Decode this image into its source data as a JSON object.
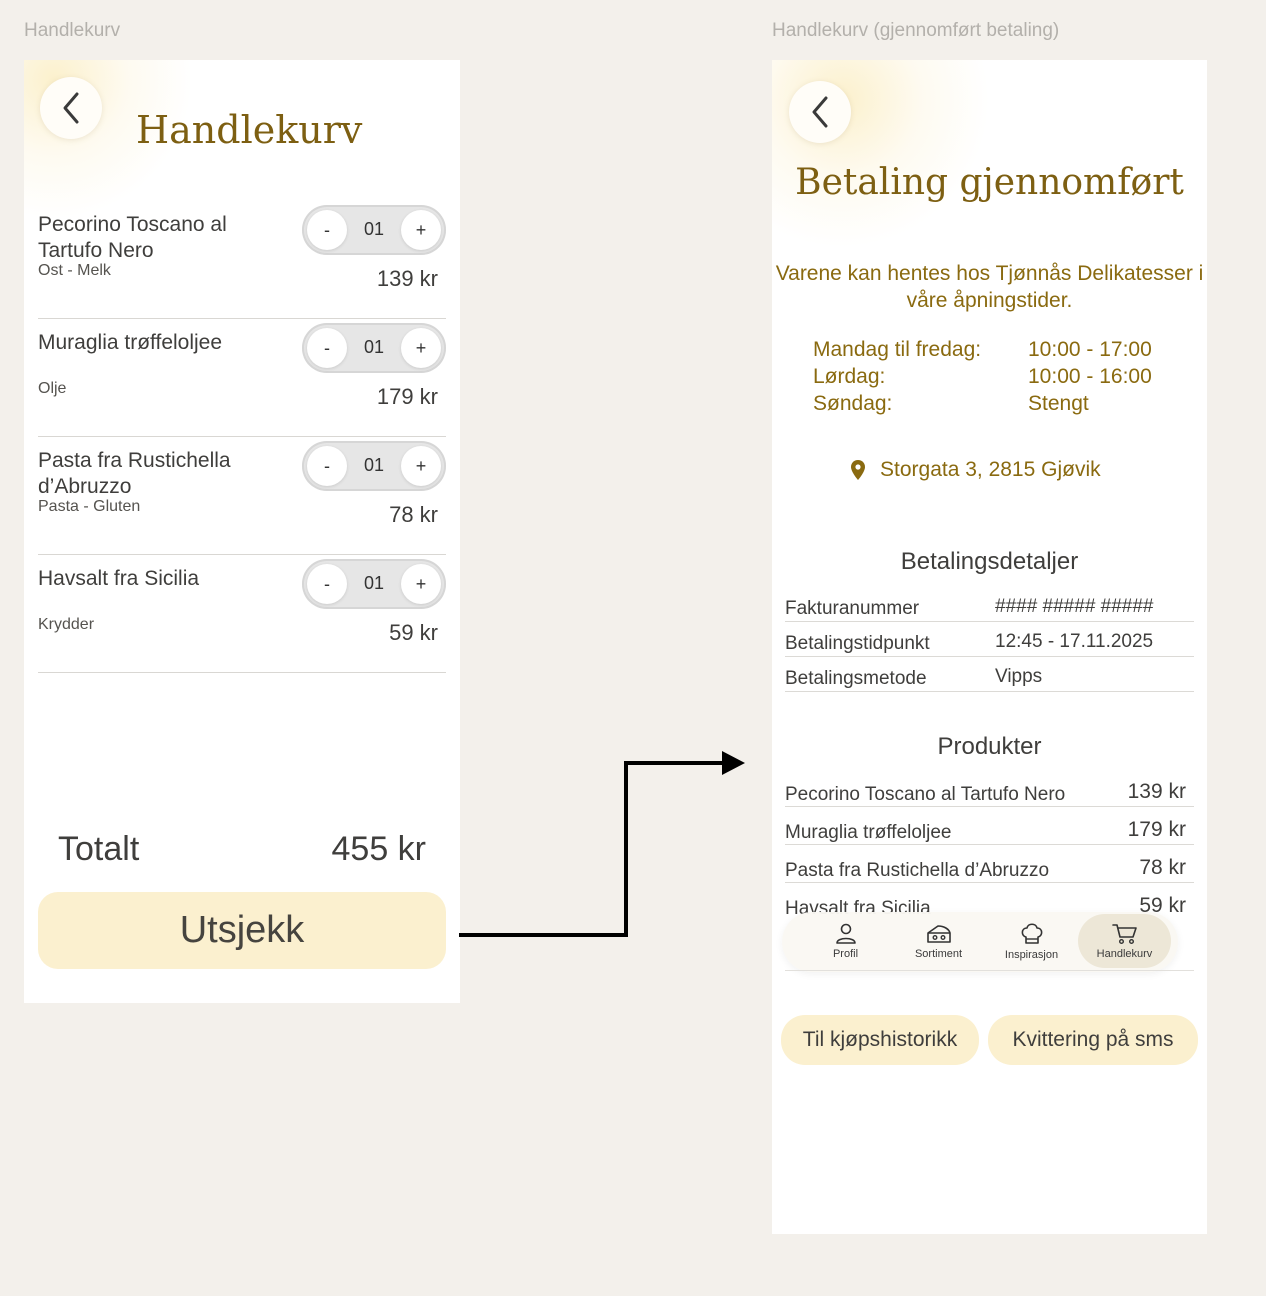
{
  "frames": {
    "left_label": "Handlekurv",
    "right_label": "Handlekurv (gjennomført betaling)"
  },
  "cart": {
    "title": "Handlekurv",
    "items": [
      {
        "name": "Pecorino Toscano al Tartufo Nero",
        "sub": "Ost - Melk",
        "qty": "01",
        "price": "139 kr"
      },
      {
        "name": "Muraglia trøffeloljee",
        "sub": "Olje",
        "qty": "01",
        "price": "179 kr"
      },
      {
        "name": "Pasta fra Rustichella d’Abruzzo",
        "sub": "Pasta - Gluten",
        "qty": "01",
        "price": "78 kr"
      },
      {
        "name": "Havsalt fra Sicilia",
        "sub": "Krydder",
        "qty": "01",
        "price": "59 kr"
      }
    ],
    "minus_label": "-",
    "plus_label": "+",
    "total_label": "Totalt",
    "total_value": "455 kr",
    "checkout_label": "Utsjekk"
  },
  "payment": {
    "title": "Betaling gjennomført",
    "pickup_text": "Varene kan hentes hos Tjønnås Delikatesser i våre åpningstider.",
    "hours": [
      {
        "day": "Mandag til fredag:",
        "time": "10:00 - 17:00"
      },
      {
        "day": "Lørdag:",
        "time": "10:00 - 16:00"
      },
      {
        "day": "Søndag:",
        "time": "Stengt"
      }
    ],
    "address": "Storgata 3, 2815 Gjøvik",
    "details_title": "Betalingsdetaljer",
    "details": [
      {
        "key": "Fakturanummer",
        "value": "#### ##### #####"
      },
      {
        "key": "Betalingstidpunkt",
        "value": "12:45 - 17.11.2025"
      },
      {
        "key": "Betalingsmetode",
        "value": "Vipps"
      }
    ],
    "products_title": "Produkter",
    "products": [
      {
        "name": "Pecorino Toscano al Tartufo Nero",
        "price": "139 kr"
      },
      {
        "name": "Muraglia trøffeloljee",
        "price": "179 kr"
      },
      {
        "name": "Pasta fra Rustichella d’Abruzzo",
        "price": "78 kr"
      },
      {
        "name": "Havsalt fra Sicilia",
        "price": "59 kr"
      }
    ],
    "nav": [
      {
        "label": "Profil",
        "icon": "user-icon"
      },
      {
        "label": "Sortiment",
        "icon": "cheese-icon"
      },
      {
        "label": "Inspirasjon",
        "icon": "chef-hat-icon"
      },
      {
        "label": "Handlekurv",
        "icon": "cart-icon",
        "active": true
      }
    ],
    "history_button": "Til kjøpshistorikk",
    "sms_button": "Kvittering på sms"
  },
  "colors": {
    "accent_gold": "#8a6a10",
    "button_cream": "#fbf0cf",
    "background": "#f3f0eb"
  }
}
